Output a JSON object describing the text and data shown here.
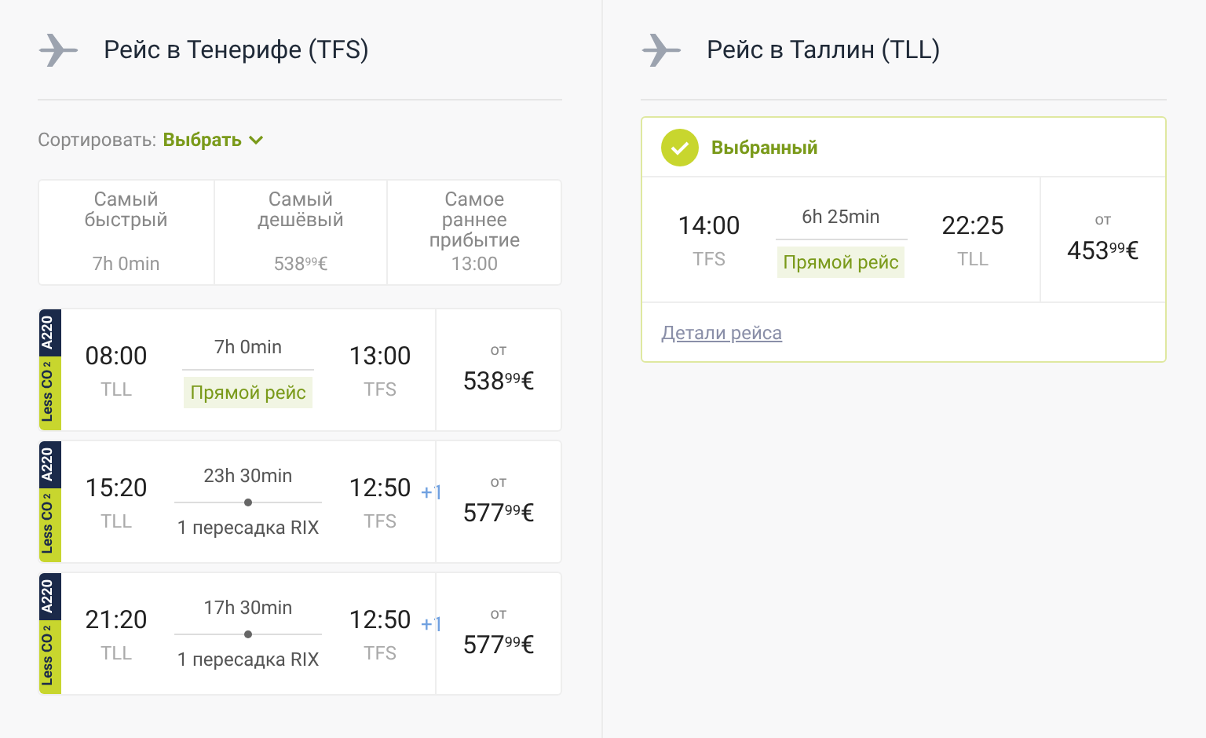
{
  "outbound": {
    "title": "Рейс в Тенерифе (TFS)",
    "sort": {
      "label": "Сортировать:",
      "value": "Выбрать"
    },
    "sort_options": [
      {
        "label": "Самый быстрый",
        "value": "7h 0min"
      },
      {
        "label": "Самый дешёвый",
        "value": "538$^{99}$€"
      },
      {
        "label": "Самое раннее прибытие",
        "value": "13:00"
      }
    ],
    "flights": [
      {
        "badge": "Less CO$_{2}$",
        "aircraft": "A220",
        "depart": "08:00",
        "from": "TLL",
        "duration": "7h 0min",
        "kind": "direct",
        "route": "Прямой рейс",
        "arrive": "13:00",
        "to": "TFS",
        "price_prefix": "от",
        "price": "538$^{99}$€"
      },
      {
        "badge": "Less CO$_{2}$",
        "aircraft": "A220",
        "depart": "15:20",
        "from": "TLL",
        "duration": "23h 30min",
        "kind": "transfer",
        "route": "1 пересадка RIX",
        "arrive": "12:50",
        "day_offset": "+1",
        "to": "TFS",
        "price_prefix": "от",
        "price": "577$^{99}$€"
      },
      {
        "badge": "Less CO$_{2}$",
        "aircraft": "A220",
        "depart": "21:20",
        "from": "TLL",
        "duration": "17h 30min",
        "kind": "transfer",
        "route": "1 пересадка RIX",
        "arrive": "12:50",
        "day_offset": "+1",
        "to": "TFS",
        "price_prefix": "от",
        "price": "577$^{99}$€"
      }
    ]
  },
  "return": {
    "title": "Рейс в Таллин (TLL)",
    "selected_flight": {
      "status": "Выбранный",
      "depart": "14:00",
      "from": "TFS",
      "duration": "6h 25min",
      "kind": "direct",
      "route": "Прямой рейс",
      "arrive": "22:25",
      "to": "TLL",
      "price_prefix": "от",
      "price": "453$^{99}$€",
      "details_link": "Детали рейса"
    }
  }
}
